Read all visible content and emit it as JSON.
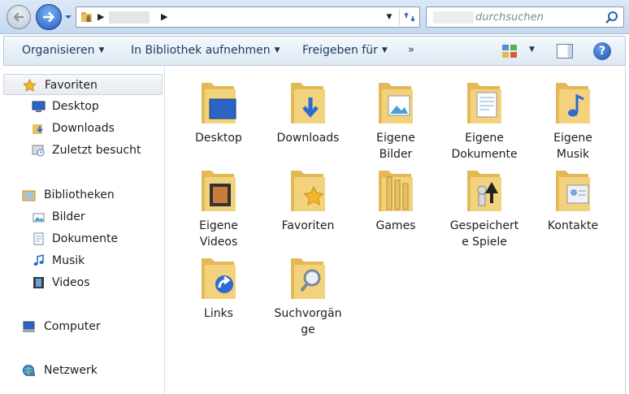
{
  "window": {
    "search_placeholder": "durchsuchen",
    "address_chevron": "▶"
  },
  "toolbar": {
    "organize": "Organisieren",
    "library": "In Bibliothek aufnehmen",
    "share": "Freigeben für",
    "more": "»",
    "help": "?"
  },
  "sidebar": {
    "favorites": {
      "header": "Favoriten",
      "items": [
        "Desktop",
        "Downloads",
        "Zuletzt besucht"
      ]
    },
    "libraries": {
      "header": "Bibliotheken",
      "items": [
        "Bilder",
        "Dokumente",
        "Musik",
        "Videos"
      ]
    },
    "computer": "Computer",
    "network": "Netzwerk"
  },
  "folders": [
    {
      "label": "Desktop",
      "overlay": "desktop"
    },
    {
      "label": "Downloads",
      "overlay": "download"
    },
    {
      "label": "Eigene\nBilder",
      "overlay": "picture"
    },
    {
      "label": "Eigene\nDokumente",
      "overlay": "document"
    },
    {
      "label": "Eigene\nMusik",
      "overlay": "music"
    },
    {
      "label": "Eigene\nVideos",
      "overlay": "video"
    },
    {
      "label": "Favoriten",
      "overlay": "star"
    },
    {
      "label": "Games",
      "overlay": "games"
    },
    {
      "label": "Gespeichert\ne Spiele",
      "overlay": "chess"
    },
    {
      "label": "Kontakte",
      "overlay": "contact"
    },
    {
      "label": "Links",
      "overlay": "link"
    },
    {
      "label": "Suchvorgän\nge",
      "overlay": "search"
    }
  ],
  "colors": {
    "folder_front": "#f3d27e",
    "folder_back": "#e3b955",
    "accent": "#1d4ea8"
  }
}
